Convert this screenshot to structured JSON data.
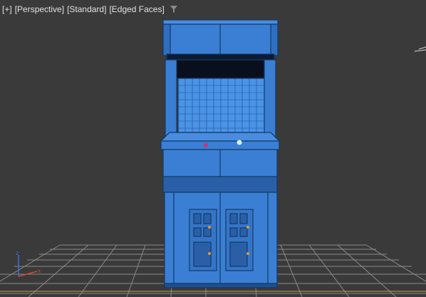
{
  "viewport": {
    "labels": [
      "[+]",
      "[Perspective]",
      "[Standard]",
      "[Edged Faces]"
    ],
    "filter_icon": "funnel-icon"
  },
  "gizmo": {
    "axis_z_color": "#3b6fe0",
    "axis_x_color": "#d24a3a"
  },
  "colors": {
    "background": "#3a3a3a",
    "grid": "#8a8a8a",
    "model_fill": "#3a7fd4",
    "model_edge": "#123a66",
    "label_text": "#e2e2e2"
  },
  "scene": {
    "object": "arcade-cabinet"
  }
}
